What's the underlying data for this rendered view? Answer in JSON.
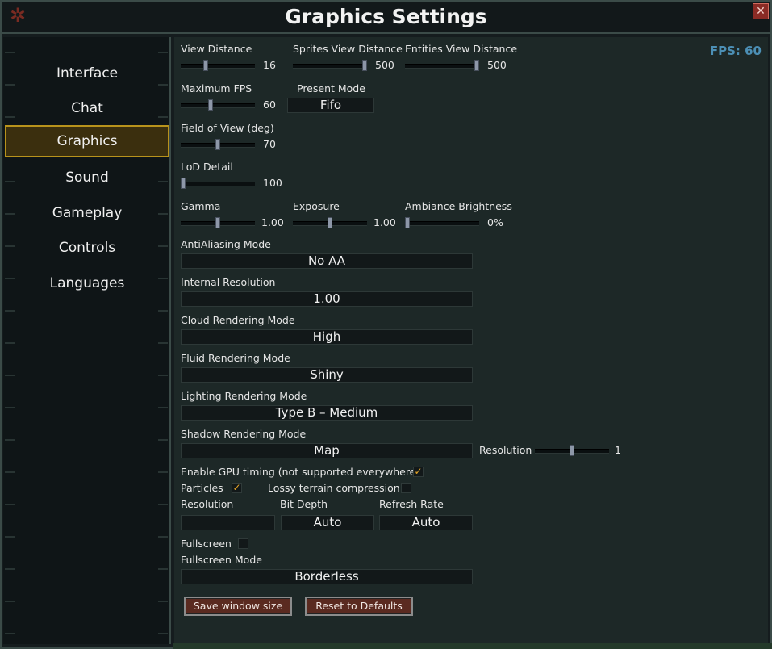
{
  "window": {
    "title": "Graphics Settings"
  },
  "sidebar": {
    "items": [
      {
        "label": "Interface"
      },
      {
        "label": "Chat"
      },
      {
        "label": "Graphics",
        "active": true
      },
      {
        "label": "Sound"
      },
      {
        "label": "Gameplay"
      },
      {
        "label": "Controls"
      },
      {
        "label": "Languages"
      }
    ]
  },
  "fps": "FPS: 60",
  "settings": {
    "view_distance": {
      "label": "View Distance",
      "value": "16",
      "level": 0.33
    },
    "sprites_view_distance": {
      "label": "Sprites View Distance",
      "value": "500",
      "level": 1.0
    },
    "entities_view_distance": {
      "label": "Entities View Distance",
      "value": "500",
      "level": 1.0
    },
    "maximum_fps": {
      "label": "Maximum FPS",
      "value": "60",
      "level": 0.39
    },
    "present_mode": {
      "label": "Present Mode",
      "value": "Fifo"
    },
    "field_of_view": {
      "label": "Field of View (deg)",
      "value": "70",
      "level": 0.5
    },
    "lod_detail": {
      "label": "LoD Detail",
      "value": "100",
      "level": 0.0
    },
    "gamma": {
      "label": "Gamma",
      "value": "1.00",
      "level": 0.5
    },
    "exposure": {
      "label": "Exposure",
      "value": "1.00",
      "level": 0.5
    },
    "ambiance_brightness": {
      "label": "Ambiance Brightness",
      "value": "0%",
      "level": 0.0
    },
    "antialiasing_mode": {
      "label": "AntiAliasing Mode",
      "value": "No AA"
    },
    "internal_resolution": {
      "label": "Internal Resolution",
      "value": "1.00"
    },
    "cloud_rendering_mode": {
      "label": "Cloud Rendering Mode",
      "value": "High"
    },
    "fluid_rendering_mode": {
      "label": "Fluid Rendering Mode",
      "value": "Shiny"
    },
    "lighting_rendering_mode": {
      "label": "Lighting Rendering Mode",
      "value": "Type B – Medium"
    },
    "shadow_rendering_mode": {
      "label": "Shadow Rendering Mode",
      "value": "Map"
    },
    "shadow_resolution": {
      "label": "Resolution",
      "value": "1",
      "level": 0.5
    },
    "gpu_timing": {
      "label": "Enable GPU timing (not supported everywhere)",
      "checked": true,
      "mark": "✓"
    },
    "particles": {
      "label": "Particles",
      "checked": true,
      "mark": "✓"
    },
    "lossy_terrain": {
      "label": "Lossy terrain compression",
      "checked": false,
      "mark": ""
    },
    "resolution": {
      "label": "Resolution",
      "value": ""
    },
    "bit_depth": {
      "label": "Bit Depth",
      "value": "Auto"
    },
    "refresh_rate": {
      "label": "Refresh Rate",
      "value": "Auto"
    },
    "fullscreen": {
      "label": "Fullscreen",
      "checked": false,
      "mark": ""
    },
    "fullscreen_mode": {
      "label": "Fullscreen Mode",
      "value": "Borderless"
    }
  },
  "buttons": {
    "save_window_size": "Save window size",
    "reset_defaults": "Reset to Defaults"
  },
  "icons": {
    "close": "close-icon",
    "gear": "gear-icon"
  },
  "colors": {
    "accent_gold": "#b8931c",
    "fps_blue": "#4c8fb5",
    "check_orange": "#e6a627",
    "button_red": "#5a2a20"
  }
}
